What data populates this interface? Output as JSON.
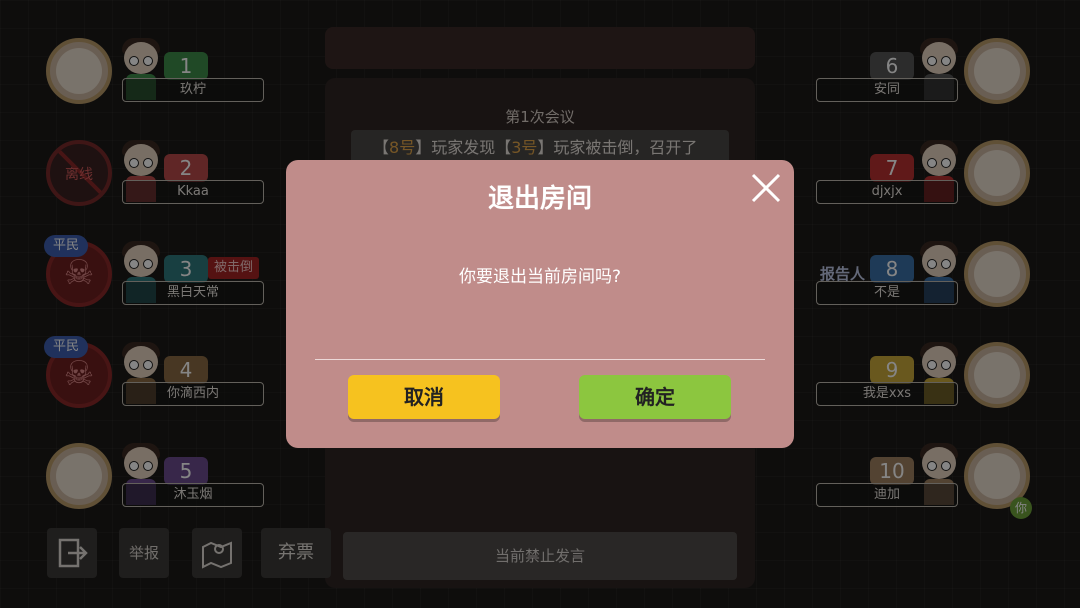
{
  "meeting": {
    "title": "第1次会议",
    "msg_pre": "【",
    "msg_a": "8号",
    "msg_mid1": "】玩家发现【",
    "msg_b": "3号",
    "msg_mid2": "】玩家被击倒，召开了",
    "chat_status": "当前禁止发言"
  },
  "players_left": [
    {
      "number": "1",
      "name": "玖柠",
      "tag_color": "#3f8c4a"
    },
    {
      "number": "2",
      "name": "Kkaa",
      "tag_color": "#b84a4a",
      "avatar_state": "离线"
    },
    {
      "number": "3",
      "name": "黑白天常",
      "tag_color": "#2f7a7e",
      "role": "平民",
      "status": "被击倒"
    },
    {
      "number": "4",
      "name": "你滴西内",
      "tag_color": "#8a6a44",
      "role": "平民"
    },
    {
      "number": "5",
      "name": "沐玉烟",
      "tag_color": "#6b4b8f"
    }
  ],
  "players_right": [
    {
      "number": "6",
      "name": "安同",
      "tag_color": "#555555"
    },
    {
      "number": "7",
      "name": "djxjx",
      "tag_color": "#b83030"
    },
    {
      "number": "8",
      "name": "不是",
      "tag_color": "#3a70a8",
      "badge": "报告人"
    },
    {
      "number": "9",
      "name": "我是xxs",
      "tag_color": "#c9a93a"
    },
    {
      "number": "10",
      "name": "迪加",
      "tag_color": "#a08060",
      "you": "你"
    }
  ],
  "bottom": {
    "report_label": "举报",
    "abstain_label": "弃票"
  },
  "dialog": {
    "title": "退出房间",
    "message": "你要退出当前房间吗?",
    "cancel_label": "取消",
    "confirm_label": "确定"
  }
}
